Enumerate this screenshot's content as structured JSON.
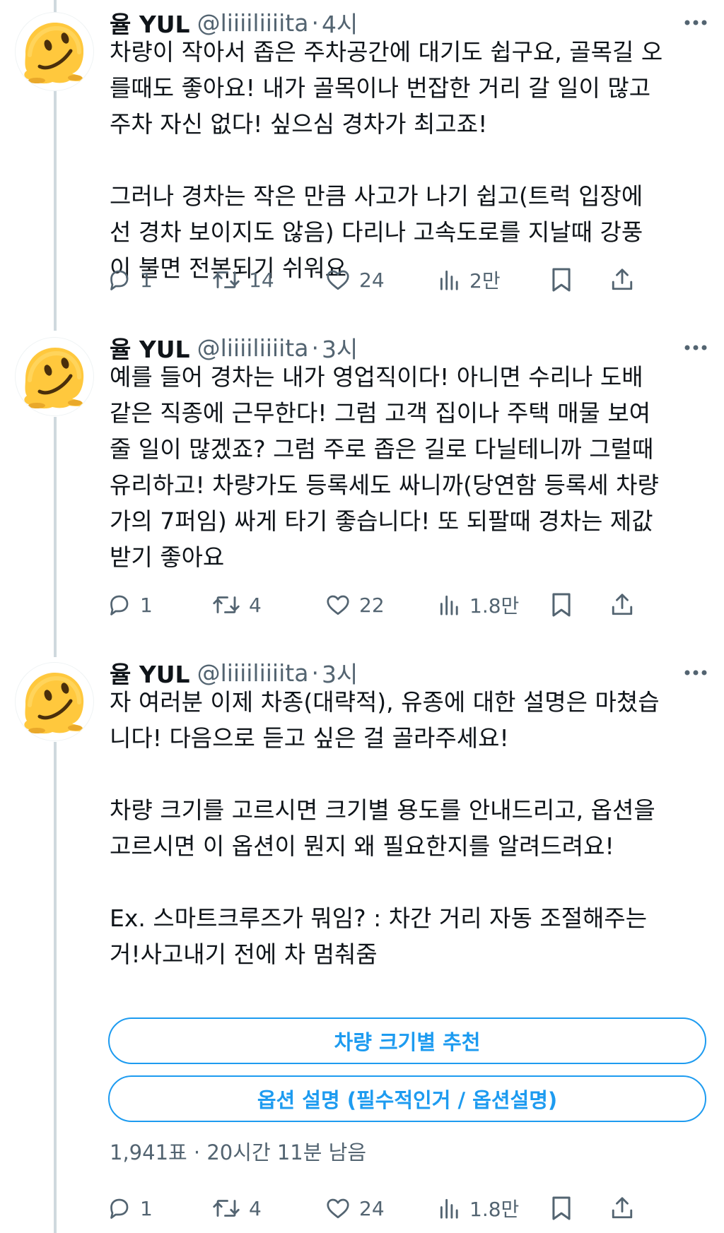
{
  "tweets": [
    {
      "author_name": "율 YUL",
      "handle": "@liiiiliiiita",
      "separator": "·",
      "time": "4시",
      "text": "차량이 작아서 좁은 주차공간에 대기도 쉽구요, 골목길 오\n를때도 좋아요! 내가 골목이나 번잡한 거리 갈 일이 많고\n주차 자신 없다! 싶으심 경차가 최고죠!\n\n그러나 경차는 작은 만큼 사고가 나기 쉽고(트럭 입장에\n선 경차 보이지도 않음) 다리나 고속도로를 지날때 강풍\n이 불면 전복되기 쉬워요",
      "replies": "1",
      "retweets": "14",
      "likes": "24",
      "views": "2만"
    },
    {
      "author_name": "율 YUL",
      "handle": "@liiiiliiiita",
      "separator": "·",
      "time": "3시",
      "text": "예를 들어 경차는 내가 영업직이다! 아니면 수리나 도배\n같은 직종에 근무한다! 그럼 고객 집이나 주택 매물 보여\n줄 일이 많겠죠? 그럼 주로 좁은 길로 다닐테니까 그럴때\n유리하고! 차량가도 등록세도 싸니까(당연함 등록세 차량\n가의 7퍼임) 싸게 타기 좋습니다! 또 되팔때 경차는 제값\n받기 좋아요",
      "replies": "1",
      "retweets": "4",
      "likes": "22",
      "views": "1.8만"
    },
    {
      "author_name": "율 YUL",
      "handle": "@liiiiliiiita",
      "separator": "·",
      "time": "3시",
      "text": "자 여러분 이제 차종(대략적), 유종에 대한 설명은 마쳤습\n니다! 다음으로 듣고 싶은 걸 골라주세요!\n\n차량 크기를 고르시면 크기별 용도를 안내드리고, 옵션을\n고르시면 이 옵션이 뭔지 왜 필요한지를 알려드려요!\n\nEx. 스마트크루즈가 뭐임? : 차간 거리 자동 조절해주는\n거!사고내기 전에 차 멈춰줌",
      "poll": {
        "options": [
          "차량 크기별 추천",
          "옵션 설명 (필수적인거 / 옵션설명)"
        ],
        "votes": "1,941표",
        "separator": "·",
        "remaining": "20시간 11분 남음"
      },
      "replies": "1",
      "retweets": "4",
      "likes": "24",
      "views": "1.8만"
    }
  ],
  "icons": {
    "more": "more-horizontal-icon",
    "reply": "reply-bubble-icon",
    "retweet": "retweet-arrows-icon",
    "like": "heart-icon",
    "views": "bar-chart-icon",
    "bookmark": "bookmark-icon",
    "share": "share-upload-icon",
    "avatar": "melting-face-emoji"
  },
  "colors": {
    "text": "#0f1419",
    "secondary": "#536471",
    "accent": "#1d9bf0",
    "thread_line": "#cfd9de",
    "background": "#ffffff"
  }
}
